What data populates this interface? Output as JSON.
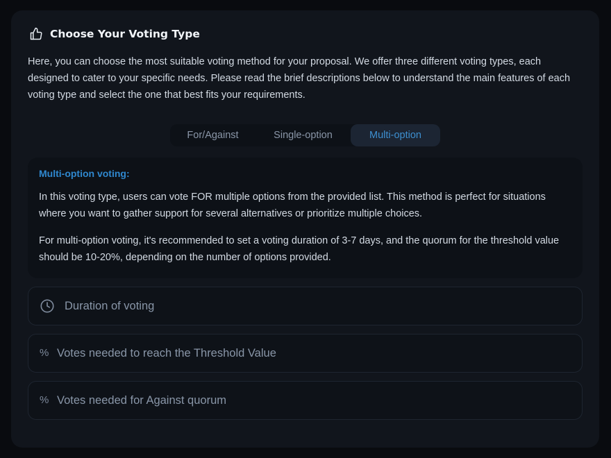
{
  "header": {
    "icon": "thumbs-up-icon",
    "title": "Choose Your Voting Type"
  },
  "intro": "Here, you can choose the most suitable voting method for your proposal. We offer three different voting types, each designed to cater to your specific needs. Please read the brief descriptions below to understand the main features of each voting type and select the one that best fits your requirements.",
  "tabs": [
    {
      "label": "For/Against",
      "active": false
    },
    {
      "label": "Single-option",
      "active": false
    },
    {
      "label": "Multi-option",
      "active": true
    }
  ],
  "description": {
    "title": "Multi-option voting:",
    "paragraph1": "In this voting type, users can vote FOR multiple options from the provided list. This method is perfect for situations where you want to gather support for several alternatives or prioritize multiple choices.",
    "paragraph2": "For multi-option voting, it's recommended to set a voting duration of 3-7 days, and the quorum for the threshold value should be 10-20%, depending on the number of options provided."
  },
  "fields": {
    "duration": {
      "icon": "clock-icon",
      "placeholder": "Duration of voting"
    },
    "threshold": {
      "icon": "percent-icon",
      "symbol": "%",
      "placeholder": "Votes needed to reach the Threshold Value"
    },
    "against": {
      "icon": "percent-icon",
      "symbol": "%",
      "placeholder": "Votes needed for Against quorum"
    }
  },
  "colors": {
    "accent": "#2f88cf",
    "card_bg": "#11151c",
    "page_bg": "#090b0f"
  }
}
